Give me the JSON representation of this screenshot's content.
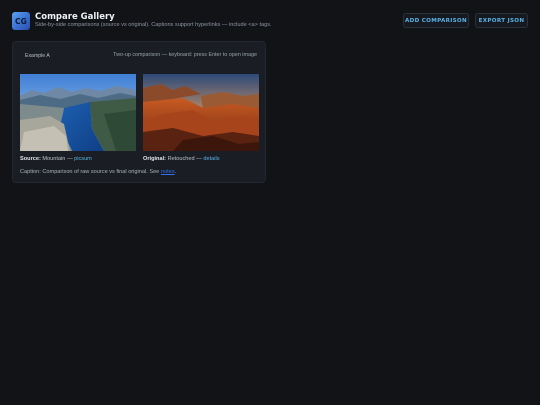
{
  "header": {
    "logo_text": "CG",
    "title": "Compare Gallery",
    "subtitle": "Side-by-side comparisons (source vs original). Captions support hyperlinks — include <a> tags.",
    "add_button": "ADD COMPARISON",
    "export_button": "EXPORT JSON"
  },
  "card": {
    "label": "Example A",
    "hint": "Two-up comparison — keyboard: press Enter to open image",
    "left": {
      "alt_icon": "mountain-fjord-photo",
      "caption_bold": "Source:",
      "caption_text": "Mountain —",
      "link_text": "picsum"
    },
    "right": {
      "alt_icon": "canyon-sunset-photo",
      "caption_bold": "Original:",
      "caption_text": "Retouched —",
      "link_text": "details"
    },
    "caption_prefix": "Caption: Comparison of raw source vs final original. See",
    "caption_link": "notes",
    "caption_suffix": "."
  },
  "colors": {
    "background": "#111317",
    "card": "#1a1d23",
    "accent": "#5ab3e8",
    "link": "#2f6ff0"
  }
}
